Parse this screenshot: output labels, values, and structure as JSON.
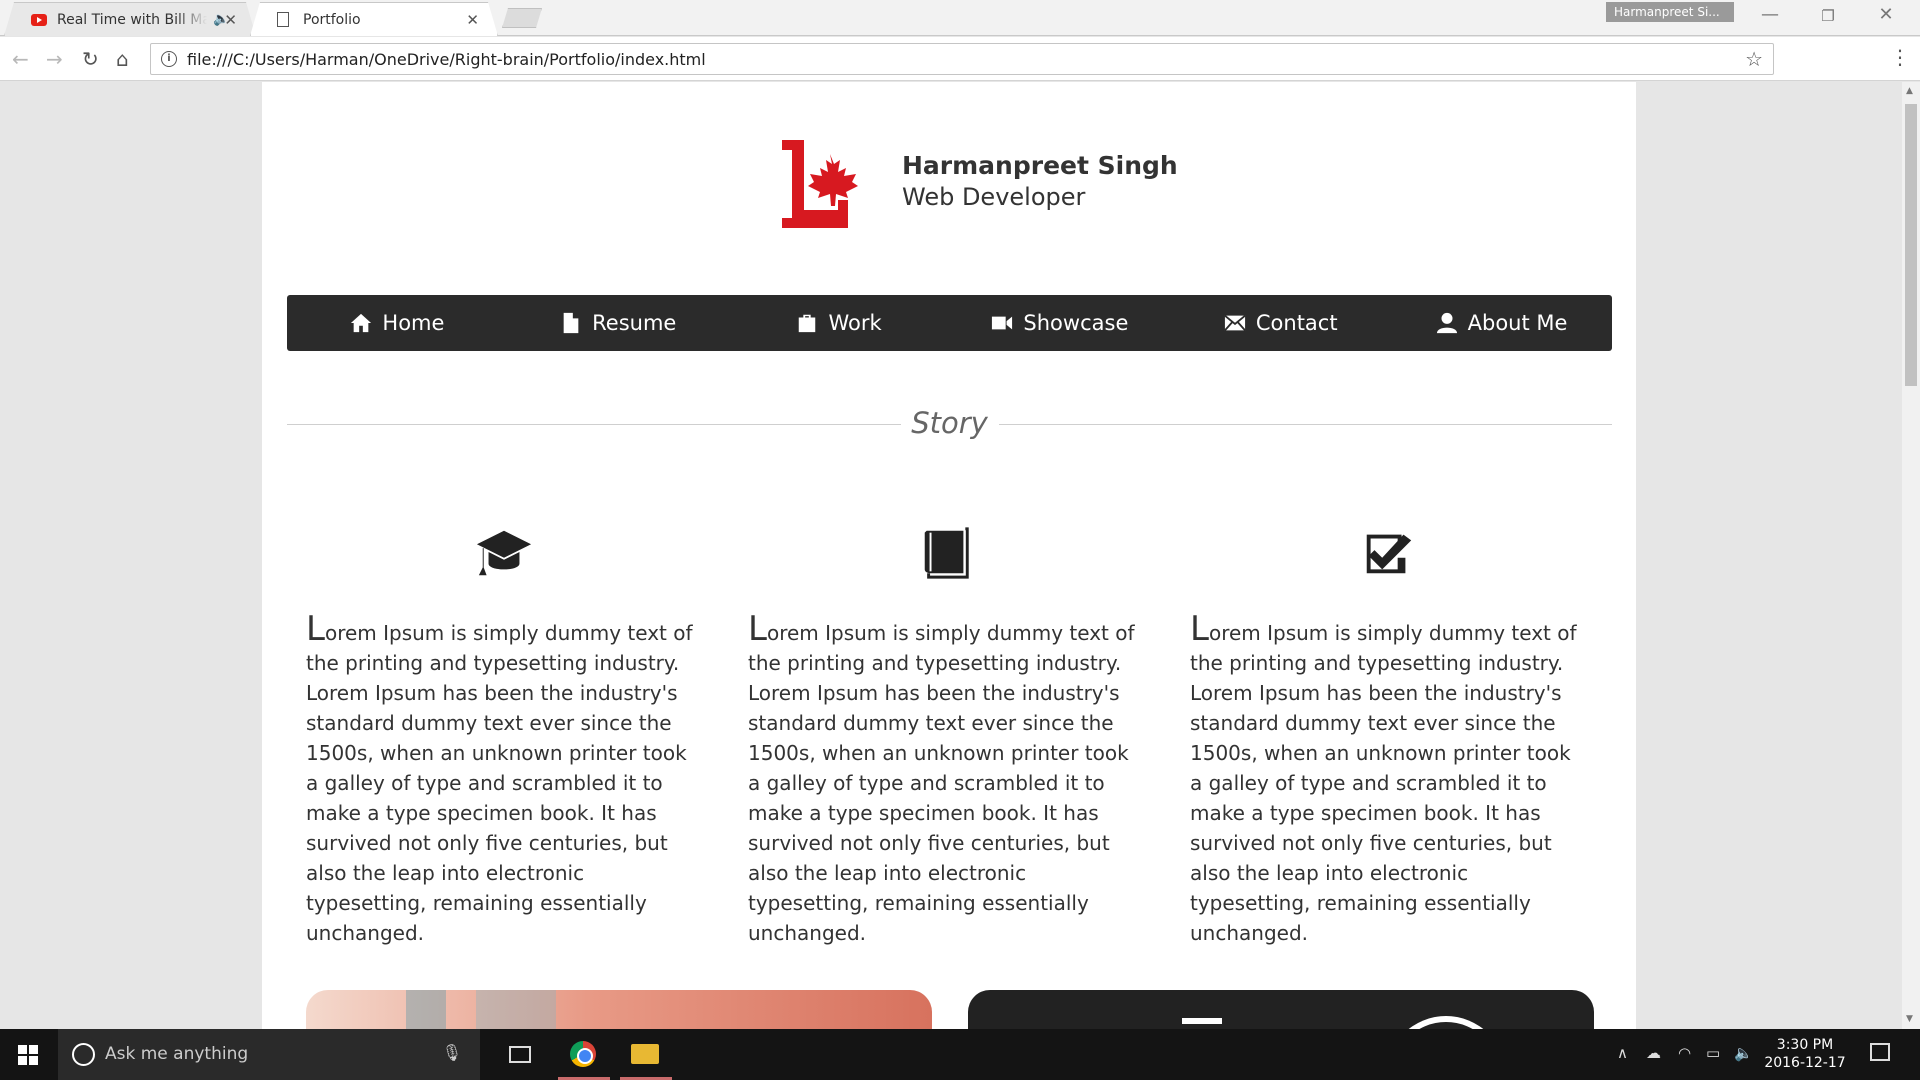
{
  "browser": {
    "tabs": [
      {
        "title": "Real Time with Bill Maher",
        "audible": true
      },
      {
        "title": "Portfolio",
        "audible": false
      }
    ],
    "profile_name": "Harmanpreet Si...",
    "url": "file:///C:/Users/Harman/OneDrive/Right-brain/Portfolio/index.html"
  },
  "site": {
    "logo_letter": "L",
    "name": "Harmanpreet Singh",
    "role": "Web Developer",
    "nav": [
      {
        "label": "Home",
        "icon": "home-icon"
      },
      {
        "label": "Resume",
        "icon": "document-icon"
      },
      {
        "label": "Work",
        "icon": "briefcase-icon"
      },
      {
        "label": "Showcase",
        "icon": "video-camera-icon"
      },
      {
        "label": "Contact",
        "icon": "envelope-icon"
      },
      {
        "label": "About Me",
        "icon": "user-icon"
      }
    ],
    "section_title": "Story",
    "columns": [
      {
        "icon": "graduation-cap-icon",
        "first_letter": "L",
        "text": "orem Ipsum is simply dummy text of the printing and typesetting industry. Lorem Ipsum has been the industry's standard dummy text ever since the 1500s, when an unknown printer took a galley of type and scrambled it to make a type specimen book. It has survived not only five centuries, but also the leap into electronic typesetting, remaining essentially unchanged."
      },
      {
        "icon": "book-icon",
        "first_letter": "L",
        "text": "orem Ipsum is simply dummy text of the printing and typesetting industry. Lorem Ipsum has been the industry's standard dummy text ever since the 1500s, when an unknown printer took a galley of type and scrambled it to make a type specimen book. It has survived not only five centuries, but also the leap into electronic typesetting, remaining essentially unchanged."
      },
      {
        "icon": "checkbox-icon",
        "first_letter": "L",
        "text": "orem Ipsum is simply dummy text of the printing and typesetting industry. Lorem Ipsum has been the industry's standard dummy text ever since the 1500s, when an unknown printer took a galley of type and scrambled it to make a type specimen book. It has survived not only five centuries, but also the leap into electronic typesetting, remaining essentially unchanged."
      }
    ]
  },
  "taskbar": {
    "search_placeholder": "Ask me anything",
    "time": "3:30 PM",
    "date": "2016-12-17"
  },
  "colors": {
    "logo_red": "#d71920",
    "nav_bg": "#2b2b2b",
    "page_bg": "#ffffff",
    "outer_bg": "#e6e6e6"
  }
}
